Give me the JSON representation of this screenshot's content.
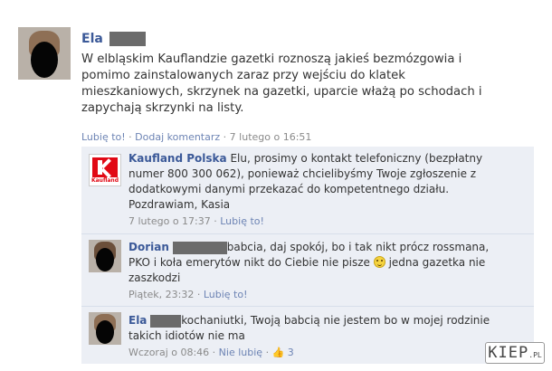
{
  "post": {
    "author": "Ela",
    "text": "W elbląskim Kauflandzie gazetki roznoszą jakieś bezmózgowia i pomimo zainstalowanych zaraz przy wejściu do klatek mieszkaniowych, skrzynek na gazetki, uparcie włażą po schodach i zapychają skrzynki na listy.",
    "like_label": "Lubię to!",
    "comment_label": "Dodaj komentarz",
    "timestamp": "7 lutego o 16:51",
    "separator": "·"
  },
  "comments": [
    {
      "author": "Kaufland Polska",
      "text": "Elu, prosimy o kontakt telefoniczny (bezpłatny numer 800 300 062), ponieważ chcielibyśmy Twoje zgłoszenie z dodatkowymi danymi przekazać do kompetentnego działu. Pozdrawiam, Kasia",
      "timestamp": "7 lutego o 17:37",
      "like_label": "Lubię to!",
      "logo_word": "Kaufland"
    },
    {
      "author": "Dorian",
      "text_before_emoticon": "babcia, daj spokój, bo i tak nikt prócz rossmana, PKO i koła emerytów nikt do Ciebie nie pisze",
      "text_after_emoticon": "jedna gazetka nie zaszkodzi",
      "timestamp": "Piątek, 23:32",
      "like_label": "Lubię to!"
    },
    {
      "author": "Ela",
      "text": "kochaniutki, Twoją babcią nie jestem bo w mojej rodzinie takich idiotów nie ma",
      "timestamp": "Wczoraj o 08:46",
      "unlike_label": "Nie lubię",
      "like_count": "3"
    }
  ],
  "watermark": {
    "brand": "KIEP",
    "suffix": ".PL"
  },
  "icons": {
    "like": "thumbs-up-icon",
    "emoticon": "smiley-icon"
  }
}
